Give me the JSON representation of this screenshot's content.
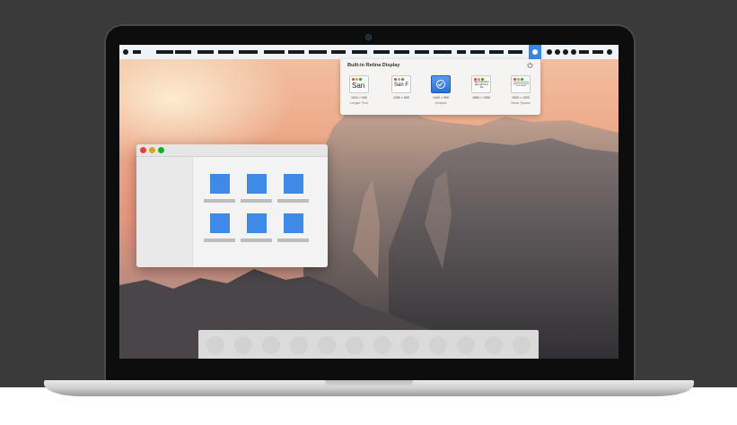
{
  "popover": {
    "title": "Built-in Retina Display",
    "resolutions": [
      {
        "thumb_text": "San",
        "dimensions": "1024 × 540",
        "caption": "Larger Text"
      },
      {
        "thumb_text": "San F",
        "dimensions": "1280 × 800",
        "caption": ""
      },
      {
        "thumb_text": "",
        "dimensions": "1440 × 900",
        "caption": "Default",
        "selected": true
      },
      {
        "thumb_text": "San Francisco that will be in the",
        "dimensions": "1680 × 1050",
        "caption": ""
      },
      {
        "thumb_text": "San Francisco that will be in the layout hash shown",
        "dimensions": "1920 × 1200",
        "caption": "More Space"
      }
    ]
  },
  "colors": {
    "accent": "#3b86e4",
    "traffic_close": "#e0443e",
    "traffic_minimize": "#dea123",
    "traffic_zoom": "#1aab29",
    "tile": "#3e8ae6"
  },
  "icons": {
    "menubar_status": "display-icon",
    "popover_power": "power-icon",
    "selected_check": "checkmark-icon"
  }
}
